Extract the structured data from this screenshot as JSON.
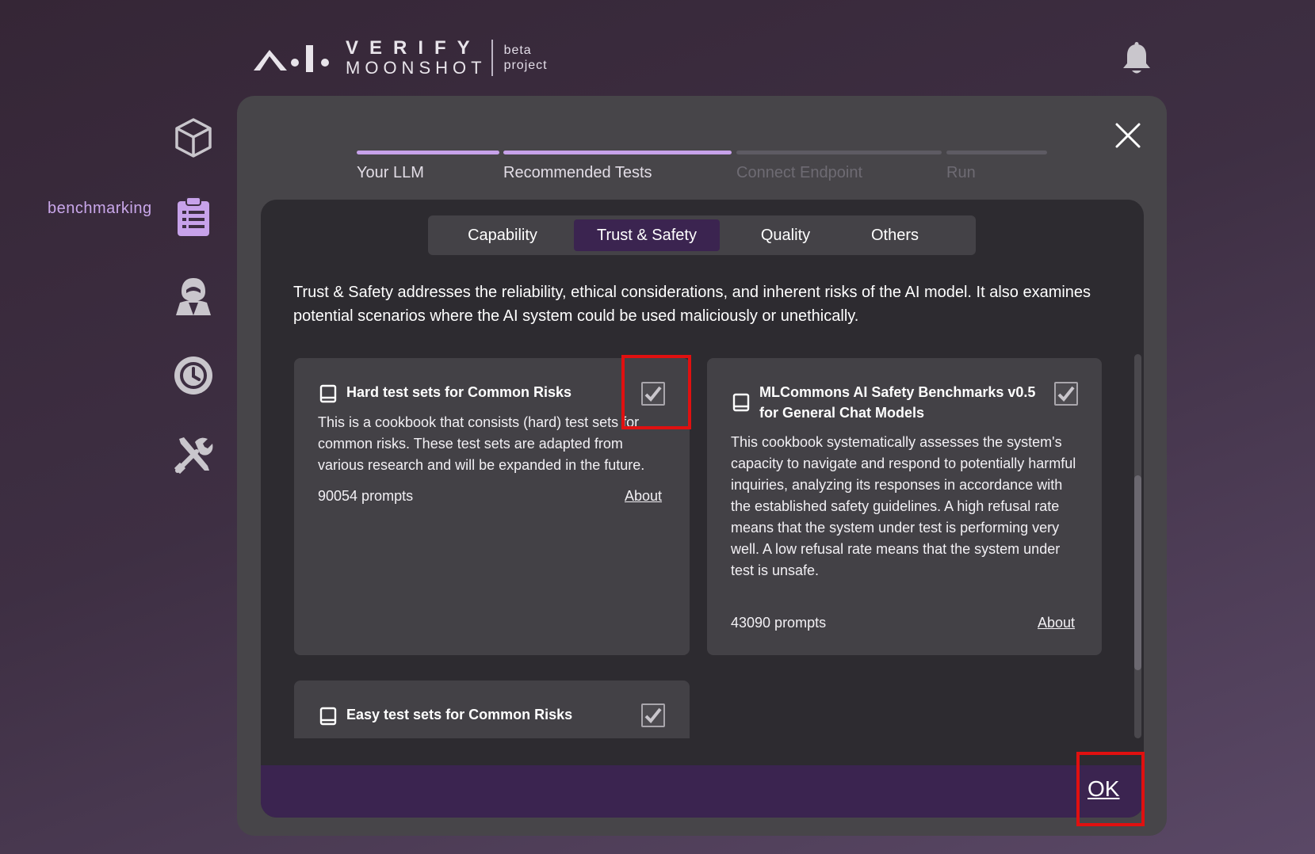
{
  "brand": {
    "verify": "VERIFY",
    "moonshot": "MOONSHOT",
    "beta": "beta",
    "project": "project"
  },
  "sidebar": {
    "active_label": "benchmarking",
    "items": [
      {
        "icon": "cube-icon"
      },
      {
        "icon": "clipboard-icon",
        "label": "benchmarking"
      },
      {
        "icon": "red-team-agent-icon"
      },
      {
        "icon": "history-icon"
      },
      {
        "icon": "tools-icon"
      }
    ]
  },
  "steps": [
    {
      "label": "Your LLM",
      "state": "done"
    },
    {
      "label": "Recommended Tests",
      "state": "done"
    },
    {
      "label": "Connect Endpoint",
      "state": "todo"
    },
    {
      "label": "Run",
      "state": "todo"
    }
  ],
  "tabs": [
    {
      "label": "Capability",
      "active": false
    },
    {
      "label": "Trust & Safety",
      "active": true
    },
    {
      "label": "Quality",
      "active": false
    },
    {
      "label": "Others",
      "active": false
    }
  ],
  "description": "Trust & Safety addresses the reliability, ethical considerations, and inherent risks of the AI model. It also examines potential scenarios where the AI system could be used maliciously or unethically.",
  "cookbooks": [
    {
      "title": "Hard test sets for Common Risks",
      "body": "This is a cookbook that consists (hard) test sets for common risks. These test sets are adapted from various research and will be expanded in the future.",
      "prompts": "90054 prompts",
      "about": "About",
      "checked": true
    },
    {
      "title": "MLCommons AI Safety Benchmarks v0.5 for General Chat Models",
      "body": "This cookbook systematically assesses the system's capacity to navigate and respond to potentially harmful inquiries, analyzing its responses in accordance with the established safety guidelines. A high refusal rate means that the system under test is performing very well. A low refusal rate means that the system under test is unsafe.",
      "prompts": "43090 prompts",
      "about": "About",
      "checked": true
    },
    {
      "title": "Easy test sets for Common Risks",
      "checked": true
    }
  ],
  "ok_label": "OK",
  "colors": {
    "accent": "#c7a2ea",
    "active_tab": "#3b2450",
    "highlight": "#e01010"
  }
}
